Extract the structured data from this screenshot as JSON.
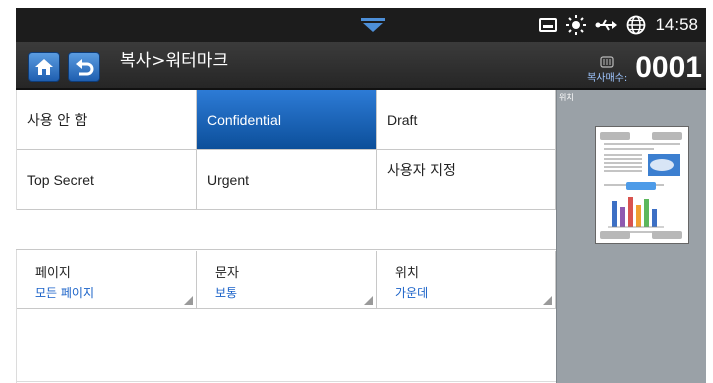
{
  "status_bar": {
    "time": "14:58",
    "icons": [
      "notification-chevron-icon",
      "tray-icon",
      "sun-icon",
      "usb-icon",
      "globe-icon"
    ]
  },
  "header": {
    "title": "복사>워터마크",
    "copies_label": "복사매수:",
    "copies_count": "0001"
  },
  "options": {
    "row1": [
      {
        "label": "사용 안 함",
        "selected": false
      },
      {
        "label": "Confidential",
        "selected": true
      },
      {
        "label": "Draft",
        "selected": false
      }
    ],
    "row2": [
      {
        "label": "Top Secret",
        "selected": false
      },
      {
        "label": "Urgent",
        "selected": false
      },
      {
        "label": "사용자 지정",
        "selected": false
      }
    ]
  },
  "settings": [
    {
      "label": "페이지",
      "value": "모든 페이지"
    },
    {
      "label": "문자",
      "value": "보통"
    },
    {
      "label": "위치",
      "value": "가운데"
    }
  ],
  "preview": {
    "label": "위치"
  },
  "colors": {
    "selected": "#1a62c8",
    "value_text": "#1a62c8",
    "status_bar": "#1c1c1c"
  }
}
